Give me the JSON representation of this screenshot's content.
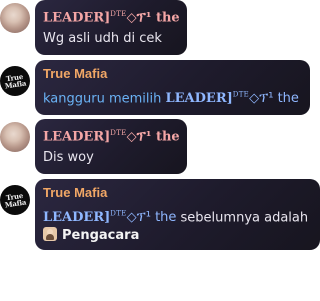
{
  "messages": [
    {
      "avatar": "photo-avatar",
      "sender": {
        "name": "LEADER]",
        "sup": "DTE",
        "suffix": "◇ፕ¹ the"
      },
      "text": "Wg asli udh di cek"
    },
    {
      "avatar": "true-mafia-logo",
      "avatar_text": "True Mafia",
      "sender": {
        "name": "True Mafia"
      },
      "text_prefix": "kangguru memilih ",
      "mention": {
        "name": "LEADER]",
        "sup": "DTE",
        "suffix": "◇ፕ¹ the"
      }
    },
    {
      "avatar": "photo-avatar",
      "sender": {
        "name": "LEADER]",
        "sup": "DTE",
        "suffix": "◇ፕ¹ the"
      },
      "text": "Dis woy"
    },
    {
      "avatar": "true-mafia-logo",
      "avatar_text": "True Mafia",
      "sender": {
        "name": "True Mafia"
      },
      "mention": {
        "name": "LEADER]",
        "sup": "DTE",
        "suffix": "◇ፕ¹ the"
      },
      "text_suffix": " sebelumnya adalah",
      "role": {
        "icon": "lawyer-icon",
        "label": "Pengacara"
      }
    }
  ],
  "colors": {
    "bubble": "#201d2e",
    "leader_name": "#f4a6a6",
    "mafia_name": "#f1a766",
    "mention": "#8fb7ff",
    "body_text": "#e9e6ef"
  }
}
